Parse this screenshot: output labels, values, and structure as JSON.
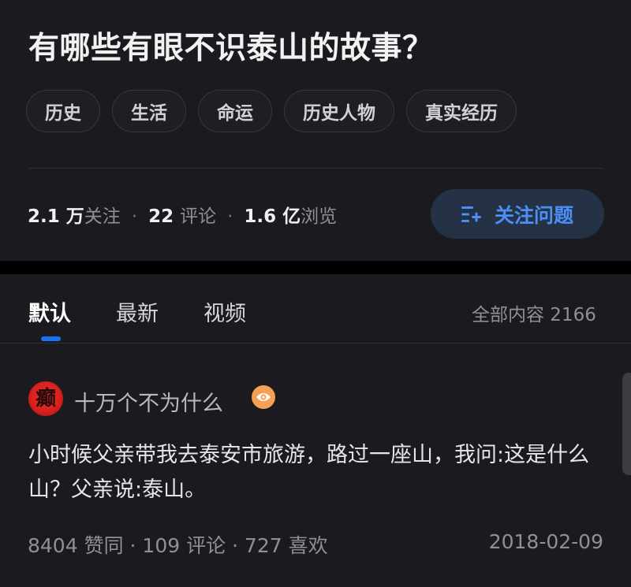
{
  "question": {
    "title": "有哪些有眼不识泰山的故事？",
    "tags": [
      "历史",
      "生活",
      "命运",
      "历史人物",
      "真实经历"
    ],
    "stats": {
      "followers_num": "2.1 万",
      "followers_label": "关注",
      "comments_num": "22",
      "comments_label": "评论",
      "views_num": "1.6 亿",
      "views_label": "浏览",
      "separator": "·"
    },
    "follow_button_label": "关注问题"
  },
  "tabs": {
    "items": [
      "默认",
      "最新",
      "视频"
    ],
    "active_index": 0,
    "total_label": "全部内容 2166"
  },
  "answer": {
    "avatar_text": "癫",
    "author": "十万个不为什么",
    "content": "小时候父亲带我去泰安市旅游，路过一座山，我问:这是什么山？父亲说:泰山。",
    "meta": "8404 赞同 · 109 评论 · 727 喜欢",
    "date": "2018-02-09"
  },
  "colors": {
    "background": "#1b1b1f",
    "accent": "#1772f6",
    "follow_button_bg": "#253246",
    "follow_button_text": "#4d8df6",
    "badge": "#f4a055"
  }
}
